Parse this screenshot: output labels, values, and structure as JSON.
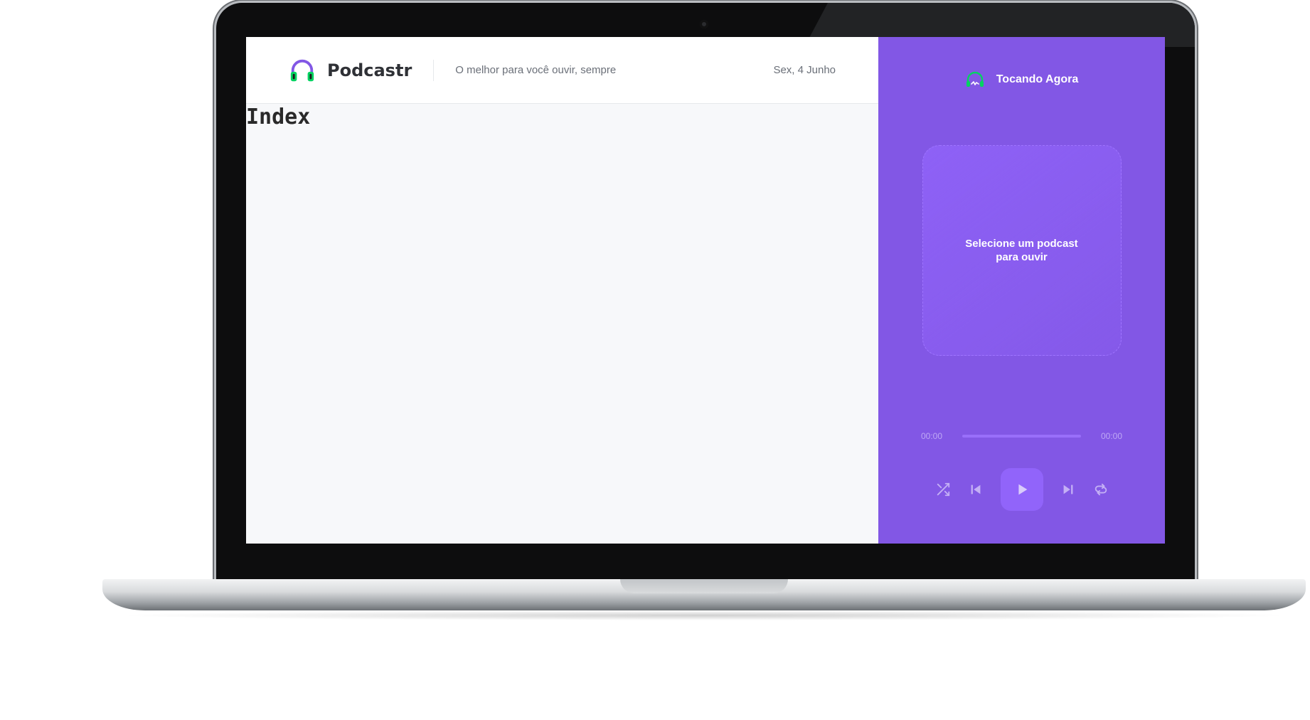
{
  "header": {
    "brand": "Podcastr",
    "tagline": "O melhor para você ouvir, sempre",
    "date": "Sex, 4 Junho"
  },
  "main": {
    "title": "Index"
  },
  "player": {
    "title": "Tocando Agora",
    "empty_message": "Selecione um podcast para ouvir",
    "current_time": "00:00",
    "duration": "00:00",
    "progress": 0,
    "controls": [
      "shuffle-icon",
      "previous-icon",
      "play-icon",
      "next-icon",
      "repeat-icon"
    ]
  },
  "colors": {
    "accent": "#8257e5",
    "logo_green": "#04d361",
    "logo_purple": "#8257e5"
  }
}
